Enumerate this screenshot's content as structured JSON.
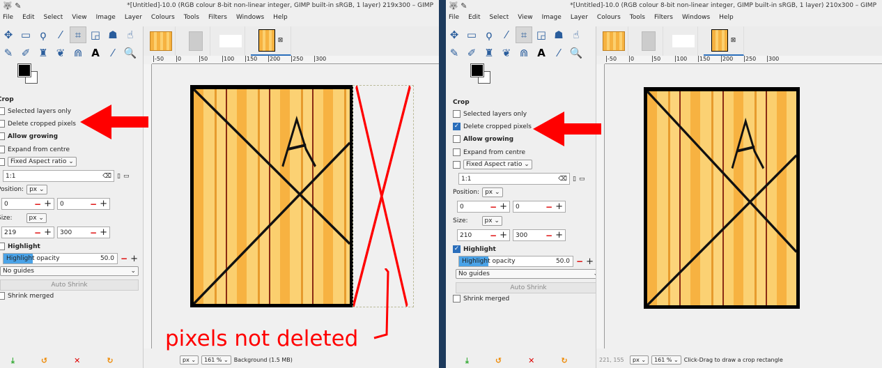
{
  "panels": [
    {
      "title": "*[Untitled]-10.0 (RGB colour 8-bit non-linear integer, GIMP built-in sRGB, 1 layer) 219x300 – GIMP",
      "menu": [
        "File",
        "Edit",
        "Select",
        "View",
        "Image",
        "Layer",
        "Colours",
        "Tools",
        "Filters",
        "Windows",
        "Help"
      ],
      "options": {
        "heading": "Crop",
        "selected_layers_only": "Selected layers only",
        "delete_cropped": "Delete cropped pixels",
        "delete_checked": false,
        "allow_growing": "Allow growing",
        "expand_centre": "Expand from centre",
        "fixed": "Fixed Aspect ratio",
        "ratio": "1:1",
        "position_label": "Position:",
        "unit": "px",
        "pos_x": "0",
        "pos_y": "0",
        "size_label": "Size:",
        "size_w": "219",
        "size_h": "300",
        "highlight": "Highlight",
        "highlight_checked": false,
        "opacity_label": "Highlight opacity",
        "opacity": "50.0",
        "opacity_pct": 50,
        "guides": "No guides",
        "auto_shrink": "Auto Shrink",
        "shrink_merged": "Shrink merged"
      },
      "ruler": [
        "-50",
        "0",
        "50",
        "100",
        "150",
        "200",
        "250",
        "300"
      ],
      "status": {
        "coords": "",
        "unit": "px",
        "zoom": "161 %",
        "message": "Background (1.5 MB)"
      },
      "annotation": "pixels not deleted"
    },
    {
      "title": "*[Untitled]-10.0 (RGB colour 8-bit non-linear integer, GIMP built-in sRGB, 1 layer) 210x300 – GIMP",
      "menu": [
        "File",
        "Edit",
        "Select",
        "View",
        "Image",
        "Layer",
        "Colours",
        "Tools",
        "Filters",
        "Windows",
        "Help"
      ],
      "options": {
        "heading": "Crop",
        "selected_layers_only": "Selected layers only",
        "delete_cropped": "Delete cropped pixels",
        "delete_checked": true,
        "allow_growing": "Allow growing",
        "expand_centre": "Expand from centre",
        "fixed": "Fixed Aspect ratio",
        "ratio": "1:1",
        "position_label": "Position:",
        "unit": "px",
        "pos_x": "0",
        "pos_y": "0",
        "size_label": "Size:",
        "size_w": "210",
        "size_h": "300",
        "highlight": "Highlight",
        "highlight_checked": true,
        "opacity_label": "Highlight opacity",
        "opacity": "50.0",
        "opacity_pct": 50,
        "guides": "No guides",
        "auto_shrink": "Auto Shrink",
        "shrink_merged": "Shrink merged"
      },
      "ruler": [
        "-50",
        "0",
        "50",
        "100",
        "150",
        "200",
        "250",
        "300"
      ],
      "status": {
        "coords": "221, 155",
        "unit": "px",
        "zoom": "161 %",
        "message": "Click-Drag to draw a crop rectangle"
      },
      "annotation": ""
    }
  ],
  "colors": {
    "arrow": "#ff0000",
    "accent": "#2a6ebb"
  }
}
